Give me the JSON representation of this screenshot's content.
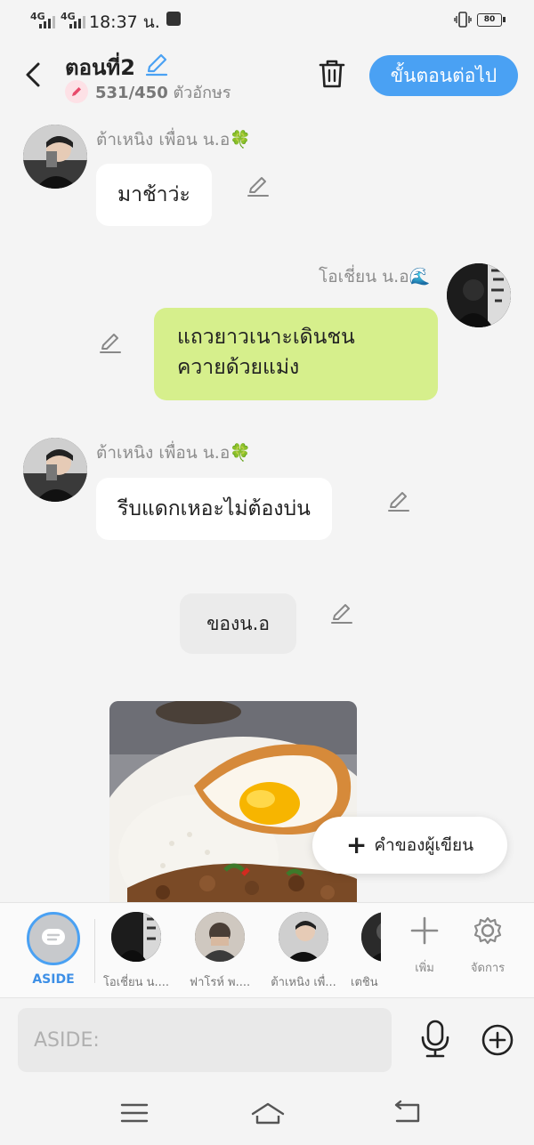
{
  "status_bar": {
    "signal1": "4G",
    "signal2": "4G",
    "time": "18:37 น.",
    "battery": "80"
  },
  "header": {
    "title": "ตอนที่2",
    "char_count": "531/450",
    "char_unit": "ตัวอักษร",
    "next_label": "ขั้นตอนต่อไป"
  },
  "messages": [
    {
      "sender": "ต้าเหนิง เพื่อน น.อ🍀",
      "text": "มาช้าว่ะ",
      "side": "left"
    },
    {
      "sender": "โอเชี่ยน น.อ🌊",
      "line1": "แถวยาวเนาะเดินชน",
      "line2": "ควายด้วยแม่ง",
      "side": "right"
    },
    {
      "sender": "ต้าเหนิง เพื่อน น.อ🍀",
      "text": "รีบแดกเหอะไม่ต้องบ่น",
      "side": "left"
    },
    {
      "text": "ของน.อ",
      "side": "center"
    }
  ],
  "author_button": {
    "label": "คำของผู้เขียน"
  },
  "char_bar": {
    "aside_label": "ASIDE",
    "characters": [
      {
        "label": "โอเชี่ยน น...."
      },
      {
        "label": "ฟาโรห์ พ...."
      },
      {
        "label": "ต้าเหนิง เพื่..."
      },
      {
        "label": "เตชิน"
      }
    ],
    "add_label": "เพิ่ม",
    "manage_label": "จัดการ"
  },
  "input": {
    "placeholder": "ASIDE:"
  },
  "colors": {
    "accent": "#4aa1f3",
    "green_bubble": "#d6ef8c",
    "background": "#f4f4f4"
  }
}
